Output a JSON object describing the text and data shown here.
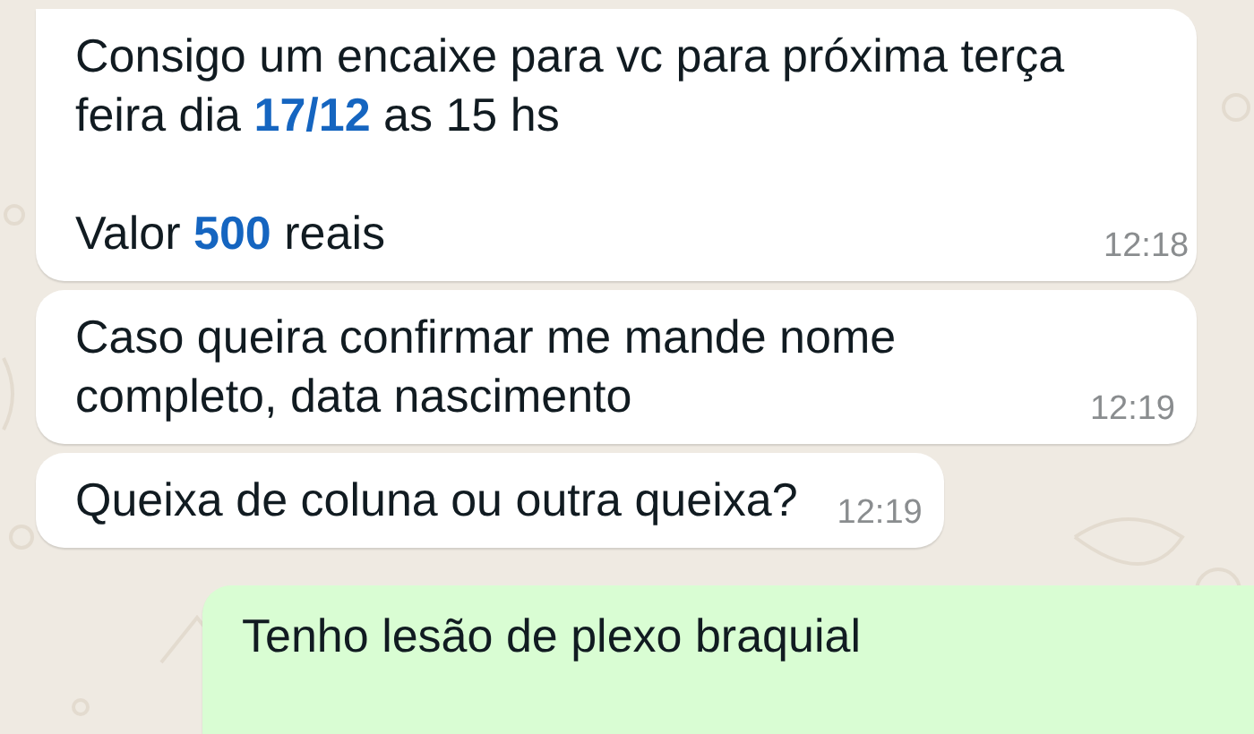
{
  "messages": [
    {
      "kind": "incoming",
      "paragraphs": [
        [
          "Consigo um encaixe para vc para próxima terça",
          "feira dia **17/12** as 15 hs"
        ],
        [
          "Valor **500** reais"
        ]
      ],
      "time": "12:18",
      "tail": true
    },
    {
      "kind": "incoming",
      "paragraphs": [
        [
          "Caso queira confirmar me mande nome",
          "completo, data nascimento"
        ]
      ],
      "time": "12:19",
      "tail": false
    },
    {
      "kind": "incoming",
      "paragraphs": [
        [
          "Queixa de coluna ou outra queixa?"
        ]
      ],
      "time": "12:19",
      "tail": false
    },
    {
      "kind": "outgoing",
      "paragraphs": [
        [
          "Tenho lesão de plexo braquial"
        ]
      ]
    }
  ]
}
